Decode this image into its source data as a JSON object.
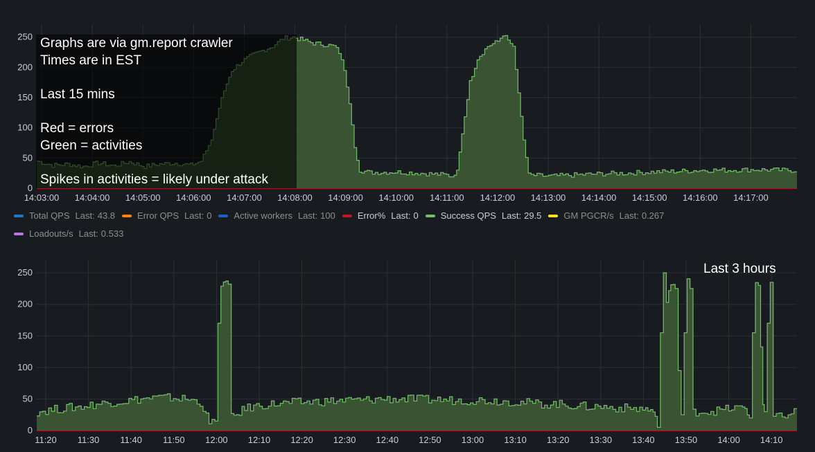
{
  "colors": {
    "background": "#181b1f",
    "grid": "#2c3035",
    "success": "#73bf69",
    "success_fill": "#3d5a35",
    "error_line": "#c4162a",
    "total_qps": "#1f78c1",
    "error_qps": "#ff7f0e",
    "active_workers": "#1f60c4",
    "error_pct": "#c4162a",
    "gm_pgcr": "#fade2a",
    "loadouts": "#b877d9"
  },
  "notes": {
    "top_lines": [
      "Graphs are via gm.report crawler",
      "Times are in EST",
      "",
      "Last 15 mins",
      "",
      "Red = errors",
      "Green = activities",
      "",
      "Spikes in activities = likely under attack"
    ],
    "bottom_label": "Last 3 hours"
  },
  "legend": {
    "last_label": "Last:",
    "items": [
      {
        "name": "Total QPS",
        "last": "43.8",
        "color": "#1f78c1",
        "bright": false
      },
      {
        "name": "Error QPS",
        "last": "0",
        "color": "#ff7f0e",
        "bright": false
      },
      {
        "name": "Active workers",
        "last": "100",
        "color": "#1f60c4",
        "bright": false
      },
      {
        "name": "Error%",
        "last": "0",
        "color": "#c4162a",
        "bright": true
      },
      {
        "name": "Success QPS",
        "last": "29.5",
        "color": "#73bf69",
        "bright": true
      },
      {
        "name": "GM PGCR/s",
        "last": "0.267",
        "color": "#fade2a",
        "bright": false
      },
      {
        "name": "Loadouts/s",
        "last": "0.533",
        "color": "#b877d9",
        "bright": false
      }
    ]
  },
  "chart_data": [
    {
      "type": "area",
      "title": "",
      "xlabel": "",
      "ylabel": "",
      "x_axis_ticks": [
        "14:03:00",
        "14:04:00",
        "14:05:00",
        "14:06:00",
        "14:07:00",
        "14:08:00",
        "14:09:00",
        "14:10:00",
        "14:11:00",
        "14:12:00",
        "14:13:00",
        "14:14:00",
        "14:15:00",
        "14:16:00",
        "14:17:00"
      ],
      "y_axis_ticks": [
        0,
        50,
        100,
        150,
        200,
        250
      ],
      "ylim": [
        0,
        260
      ],
      "grid": true,
      "legend_position": "bottom",
      "series": [
        {
          "name": "Success QPS",
          "values": [
            [
              0,
              45
            ],
            [
              0.3,
              38
            ],
            [
              0.6,
              40
            ],
            [
              0.9,
              36
            ],
            [
              1.2,
              42
            ],
            [
              1.5,
              37
            ],
            [
              1.8,
              44
            ],
            [
              2.1,
              36
            ],
            [
              2.4,
              40
            ],
            [
              2.7,
              42
            ],
            [
              3.0,
              38
            ],
            [
              3.2,
              45
            ],
            [
              3.4,
              80
            ],
            [
              3.6,
              150
            ],
            [
              3.8,
              195
            ],
            [
              4.0,
              210
            ],
            [
              4.2,
              220
            ],
            [
              4.4,
              228
            ],
            [
              4.6,
              235
            ],
            [
              4.8,
              248
            ],
            [
              5.0,
              250
            ],
            [
              5.2,
              245
            ],
            [
              5.4,
              240
            ],
            [
              5.6,
              238
            ],
            [
              5.8,
              235
            ],
            [
              5.9,
              225
            ],
            [
              6.0,
              195
            ],
            [
              6.1,
              140
            ],
            [
              6.2,
              70
            ],
            [
              6.3,
              30
            ],
            [
              6.5,
              26
            ],
            [
              7.0,
              27
            ],
            [
              7.5,
              25
            ],
            [
              8.0,
              22
            ],
            [
              8.1,
              20
            ],
            [
              8.2,
              30
            ],
            [
              8.3,
              90
            ],
            [
              8.45,
              175
            ],
            [
              8.6,
              215
            ],
            [
              8.8,
              235
            ],
            [
              9.0,
              243
            ],
            [
              9.1,
              255
            ],
            [
              9.2,
              244
            ],
            [
              9.3,
              235
            ],
            [
              9.4,
              158
            ],
            [
              9.5,
              80
            ],
            [
              9.6,
              22
            ],
            [
              10.0,
              20
            ],
            [
              10.5,
              22
            ],
            [
              11.0,
              24
            ],
            [
              11.5,
              25
            ],
            [
              12.0,
              27
            ],
            [
              12.5,
              28
            ],
            [
              13.0,
              30
            ],
            [
              13.5,
              30
            ],
            [
              14.0,
              31
            ],
            [
              14.5,
              30
            ],
            [
              14.85,
              29.5
            ]
          ]
        },
        {
          "name": "Error%",
          "values": [
            [
              0,
              0
            ],
            [
              14.85,
              0
            ]
          ]
        }
      ]
    },
    {
      "type": "area",
      "title": "",
      "xlabel": "",
      "ylabel": "",
      "x_axis_ticks": [
        "11:20",
        "11:30",
        "11:40",
        "11:50",
        "12:00",
        "12:10",
        "12:20",
        "12:30",
        "12:40",
        "12:50",
        "13:00",
        "13:10",
        "13:20",
        "13:30",
        "13:40",
        "13:50",
        "14:00",
        "14:10"
      ],
      "y_axis_ticks": [
        0,
        50,
        100,
        150,
        200,
        250
      ],
      "ylim": [
        0,
        260
      ],
      "grid": true,
      "legend_position": "none",
      "series": [
        {
          "name": "Success QPS",
          "values": [
            [
              0,
              30
            ],
            [
              1,
              33
            ],
            [
              2,
              36
            ],
            [
              3,
              38
            ],
            [
              4,
              42
            ],
            [
              5,
              45
            ],
            [
              6,
              47
            ],
            [
              7,
              50
            ],
            [
              8,
              52
            ],
            [
              9,
              52
            ],
            [
              10,
              50
            ],
            [
              11,
              45
            ],
            [
              11.6,
              10
            ],
            [
              12.0,
              15
            ],
            [
              12.2,
              170
            ],
            [
              12.4,
              235
            ],
            [
              12.9,
              232
            ],
            [
              13.1,
              20
            ],
            [
              14,
              35
            ],
            [
              15,
              40
            ],
            [
              16,
              42
            ],
            [
              17,
              44
            ],
            [
              18,
              45
            ],
            [
              19,
              46
            ],
            [
              20,
              47
            ],
            [
              21,
              48
            ],
            [
              22,
              48
            ],
            [
              23,
              50
            ],
            [
              24,
              50
            ],
            [
              25,
              50
            ],
            [
              26,
              49
            ],
            [
              27,
              49
            ],
            [
              28,
              48
            ],
            [
              29,
              48
            ],
            [
              30,
              48
            ],
            [
              31,
              47
            ],
            [
              32,
              46
            ],
            [
              33,
              44
            ],
            [
              34,
              42
            ],
            [
              35,
              42
            ],
            [
              36,
              40
            ],
            [
              37,
              38
            ],
            [
              38,
              38
            ],
            [
              39,
              36
            ],
            [
              40,
              35
            ],
            [
              41,
              34
            ],
            [
              41.5,
              30
            ],
            [
              41.8,
              5
            ],
            [
              42.0,
              155
            ],
            [
              42.2,
              245
            ],
            [
              42.4,
              210
            ],
            [
              42.7,
              232
            ],
            [
              43.0,
              225
            ],
            [
              43.2,
              95
            ],
            [
              43.4,
              25
            ],
            [
              43.6,
              155
            ],
            [
              43.8,
              235
            ],
            [
              44.0,
              225
            ],
            [
              44.2,
              30
            ],
            [
              45,
              30
            ],
            [
              46,
              32
            ],
            [
              47,
              36
            ],
            [
              47.7,
              35
            ],
            [
              48.0,
              20
            ],
            [
              48.2,
              155
            ],
            [
              48.4,
              240
            ],
            [
              48.6,
              230
            ],
            [
              48.9,
              35
            ],
            [
              49.0,
              30
            ],
            [
              49.2,
              170
            ],
            [
              49.4,
              235
            ],
            [
              49.6,
              25
            ],
            [
              50,
              28
            ],
            [
              50.4,
              22
            ],
            [
              51.2,
              30
            ]
          ]
        },
        {
          "name": "Error%",
          "values": [
            [
              0,
              0
            ],
            [
              51.2,
              0
            ]
          ]
        }
      ]
    }
  ]
}
